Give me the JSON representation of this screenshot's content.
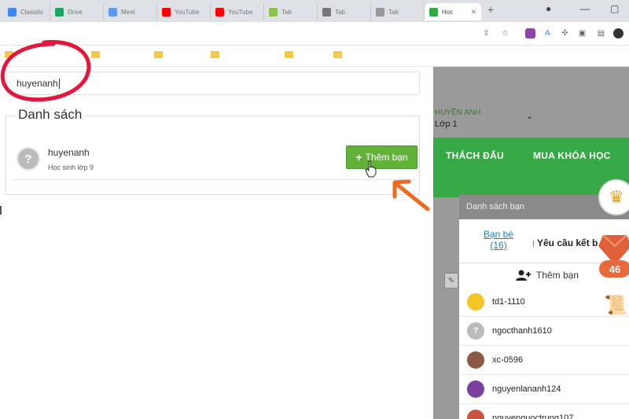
{
  "browser": {
    "tabs": [
      {
        "label": "Classdo",
        "color": "#4285f4"
      },
      {
        "label": "Drive",
        "color": "#1fa463"
      },
      {
        "label": "Meet",
        "color": "#5e97f6"
      },
      {
        "label": "YouTube",
        "color": "#ff0000"
      },
      {
        "label": "YouTube",
        "color": "#ff0000"
      },
      {
        "label": "Tab",
        "color": "#8bc34a"
      },
      {
        "label": "Tab",
        "color": "#777777"
      },
      {
        "label": "Tab",
        "color": "#999999"
      },
      {
        "label": "Hoc",
        "color": "#36a845",
        "active": true
      }
    ],
    "address": "",
    "bookmarks": [
      "",
      "",
      "",
      "",
      "",
      ""
    ]
  },
  "search": {
    "value": "huyenanh"
  },
  "list": {
    "legend": "Danh sách",
    "result": {
      "avatar": "?",
      "name": "huyenanh",
      "subtitle": "Học sinh lớp 9",
      "button": "Thêm bạn"
    }
  },
  "right": {
    "user": "HUYỀN ANH",
    "class": "Lớp 1",
    "nav": [
      "THÁCH ĐẤU",
      "MUA KHÓA HỌC"
    ],
    "friends_panel": {
      "title": "Danh sách bạn",
      "tab_friends": "Bạn bè",
      "tab_friends_count": "(16)",
      "tab_requests": "Yêu cầu kết b",
      "add_label": "Thêm bạn",
      "items": [
        {
          "name": "td1-1110",
          "avatar_color": "#f3c623"
        },
        {
          "name": "ngocthanh1610",
          "avatar_color": "#bbbbbb"
        },
        {
          "name": "xc-0596",
          "avatar_color": "#8a5a44"
        },
        {
          "name": "nguyenlananh124",
          "avatar_color": "#7b3fa0"
        },
        {
          "name": "nguyenquoctrung107",
          "avatar_color": "#c8553d"
        }
      ]
    },
    "badges": {
      "gem_count": "46"
    }
  },
  "colors": {
    "accent_green": "#36a845",
    "button_green": "#62b23a",
    "annotation_red": "#e3173e",
    "annotation_orange": "#ee6a1f"
  }
}
